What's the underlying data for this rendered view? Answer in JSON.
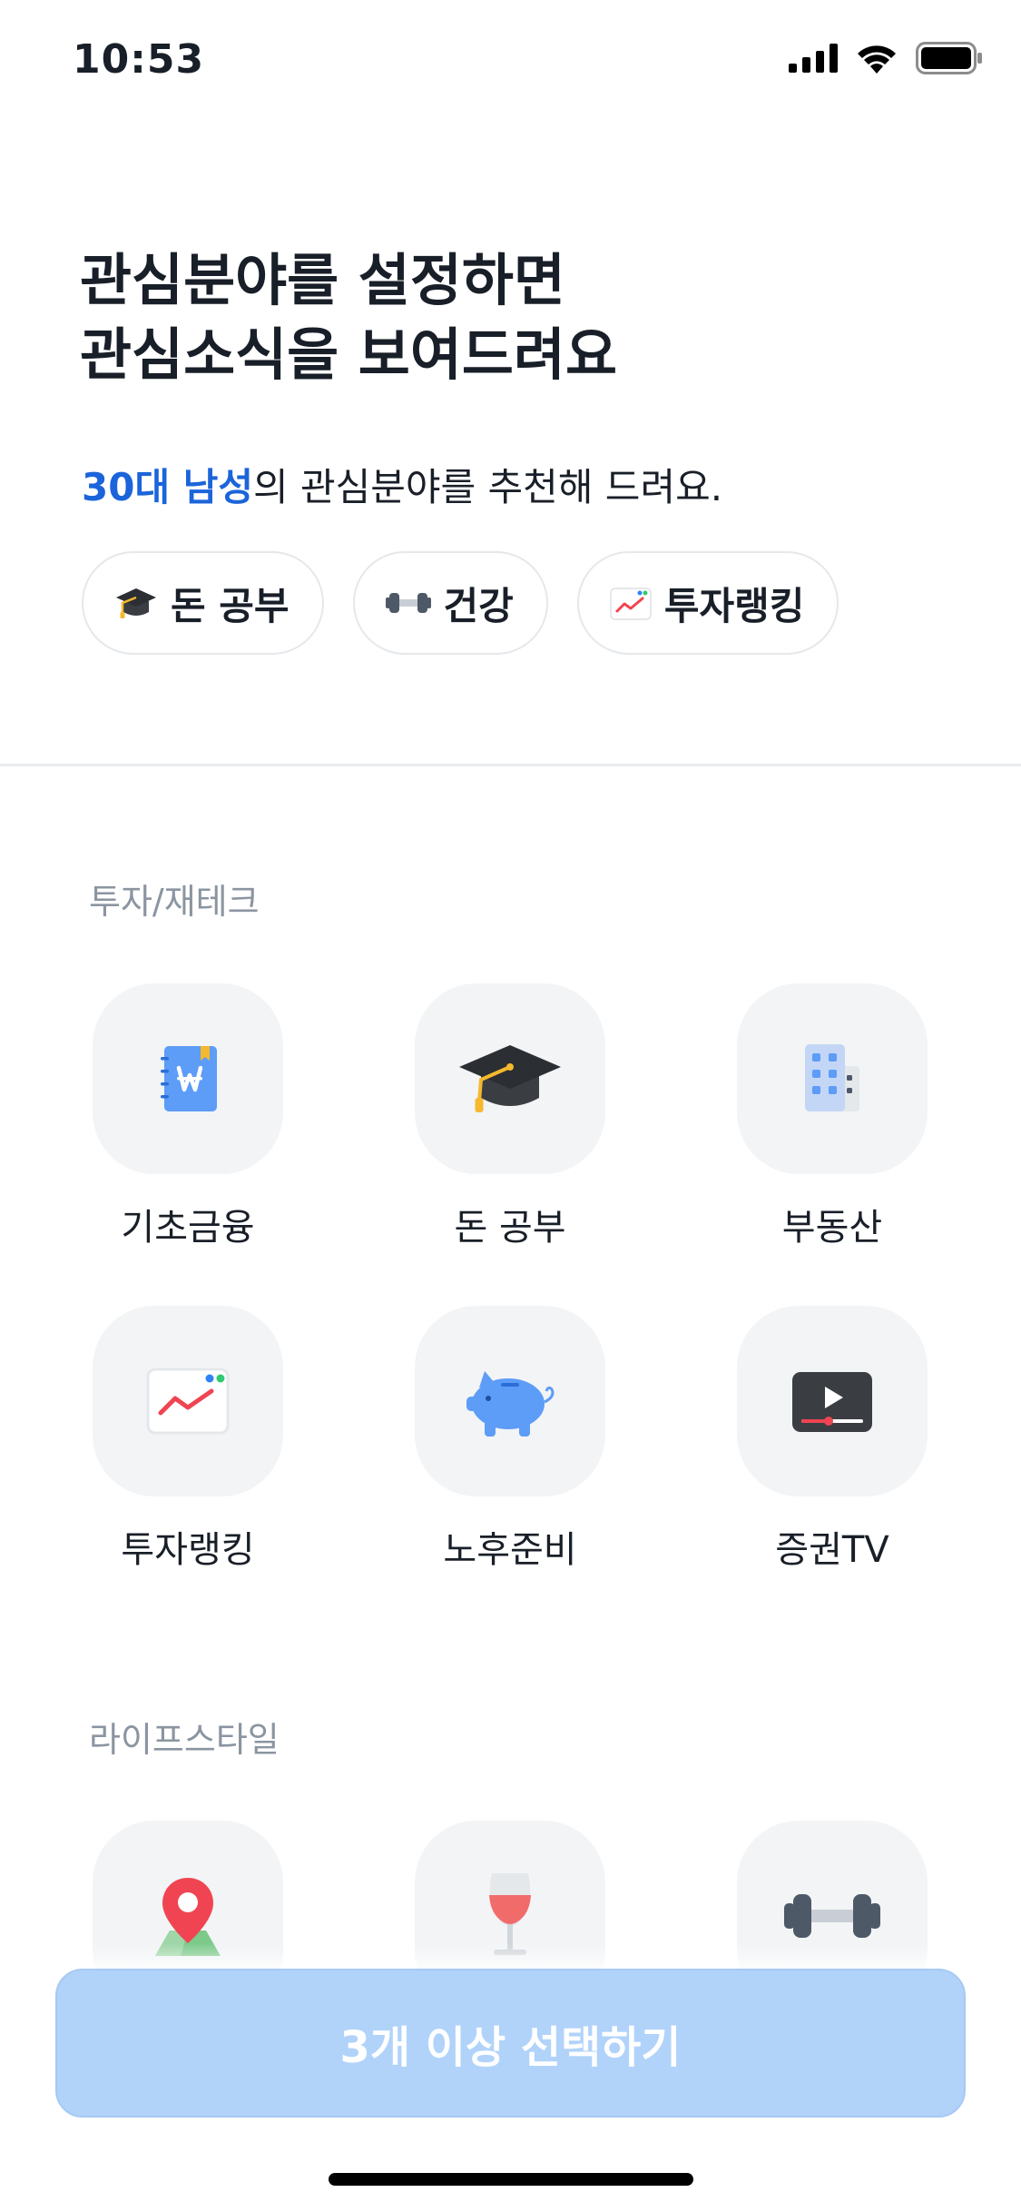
{
  "status_bar": {
    "time": "10:53"
  },
  "headline": {
    "line1": "관심분야를 설정하면",
    "line2": "관심소식을 보여드려요"
  },
  "recommendation": {
    "highlight": "30대 남성",
    "rest": "의 관심분야를 추천해 드려요."
  },
  "recommended_chips": [
    {
      "label": "돈 공부",
      "icon": "graduation-cap-icon"
    },
    {
      "label": "건강",
      "icon": "dumbbell-icon"
    },
    {
      "label": "투자랭킹",
      "icon": "chart-icon"
    }
  ],
  "sections": [
    {
      "title": "투자/재테크",
      "items": [
        {
          "label": "기초금융",
          "icon": "won-notebook-icon"
        },
        {
          "label": "돈 공부",
          "icon": "graduation-cap-icon"
        },
        {
          "label": "부동산",
          "icon": "building-icon"
        },
        {
          "label": "투자랭킹",
          "icon": "chart-icon"
        },
        {
          "label": "노후준비",
          "icon": "piggy-bank-icon"
        },
        {
          "label": "증권TV",
          "icon": "video-player-icon"
        }
      ]
    },
    {
      "title": "라이프스타일",
      "items": [
        {
          "label": "",
          "icon": "map-pin-icon"
        },
        {
          "label": "",
          "icon": "wine-glass-icon"
        },
        {
          "label": "",
          "icon": "dumbbell-icon"
        }
      ]
    }
  ],
  "cta": {
    "label": "3개 이상 선택하기"
  },
  "colors": {
    "accent": "#1b64da",
    "cta_disabled": "#b1d3fa",
    "tile_bg": "#f2f4f6",
    "section_title": "#8b95a1"
  }
}
